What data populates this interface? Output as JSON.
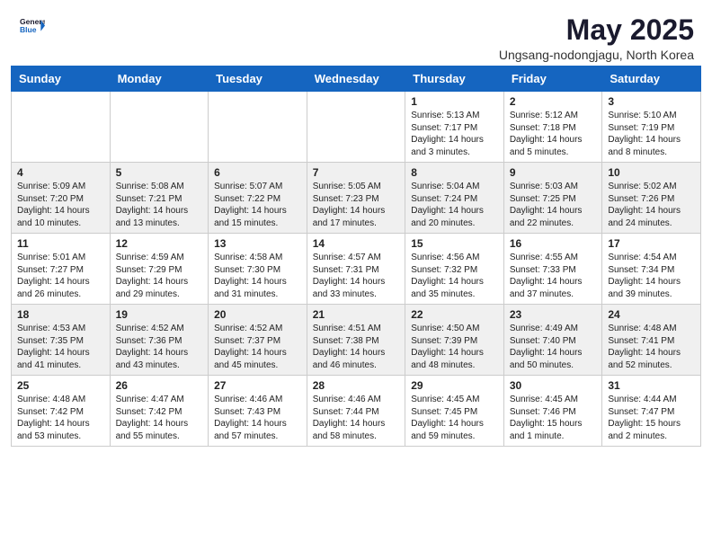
{
  "header": {
    "logo_general": "General",
    "logo_blue": "Blue",
    "month_title": "May 2025",
    "location": "Ungsang-nodongjagu, North Korea"
  },
  "weekdays": [
    "Sunday",
    "Monday",
    "Tuesday",
    "Wednesday",
    "Thursday",
    "Friday",
    "Saturday"
  ],
  "weeks": [
    [
      {
        "day": "",
        "text": ""
      },
      {
        "day": "",
        "text": ""
      },
      {
        "day": "",
        "text": ""
      },
      {
        "day": "",
        "text": ""
      },
      {
        "day": "1",
        "text": "Sunrise: 5:13 AM\nSunset: 7:17 PM\nDaylight: 14 hours\nand 3 minutes."
      },
      {
        "day": "2",
        "text": "Sunrise: 5:12 AM\nSunset: 7:18 PM\nDaylight: 14 hours\nand 5 minutes."
      },
      {
        "day": "3",
        "text": "Sunrise: 5:10 AM\nSunset: 7:19 PM\nDaylight: 14 hours\nand 8 minutes."
      }
    ],
    [
      {
        "day": "4",
        "text": "Sunrise: 5:09 AM\nSunset: 7:20 PM\nDaylight: 14 hours\nand 10 minutes."
      },
      {
        "day": "5",
        "text": "Sunrise: 5:08 AM\nSunset: 7:21 PM\nDaylight: 14 hours\nand 13 minutes."
      },
      {
        "day": "6",
        "text": "Sunrise: 5:07 AM\nSunset: 7:22 PM\nDaylight: 14 hours\nand 15 minutes."
      },
      {
        "day": "7",
        "text": "Sunrise: 5:05 AM\nSunset: 7:23 PM\nDaylight: 14 hours\nand 17 minutes."
      },
      {
        "day": "8",
        "text": "Sunrise: 5:04 AM\nSunset: 7:24 PM\nDaylight: 14 hours\nand 20 minutes."
      },
      {
        "day": "9",
        "text": "Sunrise: 5:03 AM\nSunset: 7:25 PM\nDaylight: 14 hours\nand 22 minutes."
      },
      {
        "day": "10",
        "text": "Sunrise: 5:02 AM\nSunset: 7:26 PM\nDaylight: 14 hours\nand 24 minutes."
      }
    ],
    [
      {
        "day": "11",
        "text": "Sunrise: 5:01 AM\nSunset: 7:27 PM\nDaylight: 14 hours\nand 26 minutes."
      },
      {
        "day": "12",
        "text": "Sunrise: 4:59 AM\nSunset: 7:29 PM\nDaylight: 14 hours\nand 29 minutes."
      },
      {
        "day": "13",
        "text": "Sunrise: 4:58 AM\nSunset: 7:30 PM\nDaylight: 14 hours\nand 31 minutes."
      },
      {
        "day": "14",
        "text": "Sunrise: 4:57 AM\nSunset: 7:31 PM\nDaylight: 14 hours\nand 33 minutes."
      },
      {
        "day": "15",
        "text": "Sunrise: 4:56 AM\nSunset: 7:32 PM\nDaylight: 14 hours\nand 35 minutes."
      },
      {
        "day": "16",
        "text": "Sunrise: 4:55 AM\nSunset: 7:33 PM\nDaylight: 14 hours\nand 37 minutes."
      },
      {
        "day": "17",
        "text": "Sunrise: 4:54 AM\nSunset: 7:34 PM\nDaylight: 14 hours\nand 39 minutes."
      }
    ],
    [
      {
        "day": "18",
        "text": "Sunrise: 4:53 AM\nSunset: 7:35 PM\nDaylight: 14 hours\nand 41 minutes."
      },
      {
        "day": "19",
        "text": "Sunrise: 4:52 AM\nSunset: 7:36 PM\nDaylight: 14 hours\nand 43 minutes."
      },
      {
        "day": "20",
        "text": "Sunrise: 4:52 AM\nSunset: 7:37 PM\nDaylight: 14 hours\nand 45 minutes."
      },
      {
        "day": "21",
        "text": "Sunrise: 4:51 AM\nSunset: 7:38 PM\nDaylight: 14 hours\nand 46 minutes."
      },
      {
        "day": "22",
        "text": "Sunrise: 4:50 AM\nSunset: 7:39 PM\nDaylight: 14 hours\nand 48 minutes."
      },
      {
        "day": "23",
        "text": "Sunrise: 4:49 AM\nSunset: 7:40 PM\nDaylight: 14 hours\nand 50 minutes."
      },
      {
        "day": "24",
        "text": "Sunrise: 4:48 AM\nSunset: 7:41 PM\nDaylight: 14 hours\nand 52 minutes."
      }
    ],
    [
      {
        "day": "25",
        "text": "Sunrise: 4:48 AM\nSunset: 7:42 PM\nDaylight: 14 hours\nand 53 minutes."
      },
      {
        "day": "26",
        "text": "Sunrise: 4:47 AM\nSunset: 7:42 PM\nDaylight: 14 hours\nand 55 minutes."
      },
      {
        "day": "27",
        "text": "Sunrise: 4:46 AM\nSunset: 7:43 PM\nDaylight: 14 hours\nand 57 minutes."
      },
      {
        "day": "28",
        "text": "Sunrise: 4:46 AM\nSunset: 7:44 PM\nDaylight: 14 hours\nand 58 minutes."
      },
      {
        "day": "29",
        "text": "Sunrise: 4:45 AM\nSunset: 7:45 PM\nDaylight: 14 hours\nand 59 minutes."
      },
      {
        "day": "30",
        "text": "Sunrise: 4:45 AM\nSunset: 7:46 PM\nDaylight: 15 hours\nand 1 minute."
      },
      {
        "day": "31",
        "text": "Sunrise: 4:44 AM\nSunset: 7:47 PM\nDaylight: 15 hours\nand 2 minutes."
      }
    ]
  ]
}
